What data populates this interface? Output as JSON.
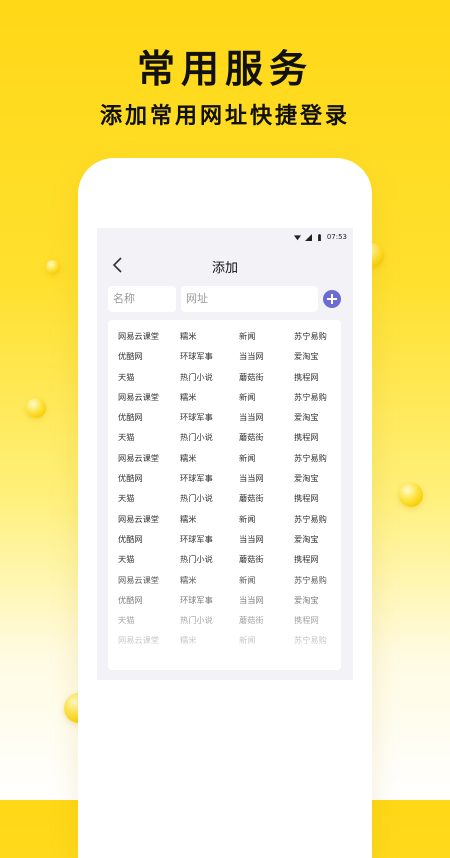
{
  "promo": {
    "title": "常用服务",
    "subtitle": "添加常用网址快捷登录"
  },
  "status_bar": {
    "time": "07:53",
    "icons": [
      "wifi-icon",
      "signal-icon",
      "battery-icon"
    ]
  },
  "nav": {
    "back_icon": "chevron-left-icon",
    "title": "添加"
  },
  "form": {
    "name_placeholder": "名称",
    "url_placeholder": "网址",
    "add_icon": "plus-circle-icon"
  },
  "sites": [
    "网易云课堂",
    "糯米",
    "新闻",
    "苏宁易购",
    "优酷网",
    "环球军事",
    "当当网",
    "爱淘宝",
    "天猫",
    "热门小说",
    "蘑菇街",
    "携程网",
    "网易云课堂",
    "糯米",
    "新闻",
    "苏宁易购",
    "优酷网",
    "环球军事",
    "当当网",
    "爱淘宝",
    "天猫",
    "热门小说",
    "蘑菇街",
    "携程网",
    "网易云课堂",
    "糯米",
    "新闻",
    "苏宁易购",
    "优酷网",
    "环球军事",
    "当当网",
    "爱淘宝",
    "天猫",
    "热门小说",
    "蘑菇街",
    "携程网",
    "网易云课堂",
    "糯米",
    "新闻",
    "苏宁易购",
    "优酷网",
    "环球军事",
    "当当网",
    "爱淘宝",
    "天猫",
    "热门小说",
    "蘑菇街",
    "携程网",
    "网易云课堂",
    "糯米",
    "新闻",
    "苏宁易购",
    "优酷网",
    "环球军事",
    "当当网",
    "爱淘宝",
    "天猫",
    "热门小说",
    "蘑菇街",
    "携程网",
    "网易云课堂",
    "糯米",
    "新闻",
    "苏宁易购"
  ],
  "colors": {
    "background_top": "#ffd817",
    "accent": "#6b6bd6"
  }
}
